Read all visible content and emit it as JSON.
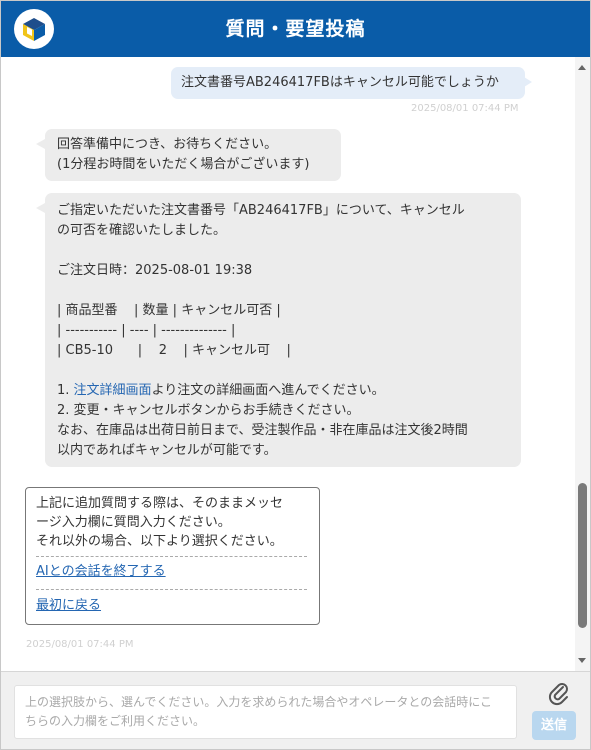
{
  "header": {
    "title": "質問・要望投稿",
    "logo": "cube-logo"
  },
  "messages": {
    "user_question": "注文書番号AB246417FBはキャンセル可能でしょうか",
    "user_timestamp": "2025/08/01 07:44 PM",
    "waiting": [
      "回答準備中につき、お待ちください。",
      "(1分程お時間をいただく場合がございます)"
    ],
    "answer": {
      "intro": [
        "ご指定いただいた注文書番号「AB246417FB」について、キャンセル",
        "の可否を確認いたしました。"
      ],
      "order_date": "ご注文日時：2025-08-01 19:38",
      "table": [
        "| 商品型番    | 数量 | キャンセル可否 |",
        "| ----------- | ---- | -------------- |",
        "| CB5-10      |    2    | キャンセル可    |"
      ],
      "step1_num": "1. ",
      "step1_link": "注文詳細画面",
      "step1_rest": "より注文の詳細画面へ進んでください。",
      "step2": "2. 変更・キャンセルボタンからお手続きください。",
      "note": [
        "なお、在庫品は出荷日前日まで、受注製作品・非在庫品は注文後2時間",
        "以内であればキャンセルが可能です。"
      ]
    },
    "choices": {
      "intro": [
        "上記に追加質問する際は、そのままメッセ",
        "ージ入力欄に質問入力ください。",
        "それ以外の場合、以下より選択ください。"
      ],
      "end_chat": "AIとの会話を終了する",
      "back_to_start": "最初に戻る"
    },
    "bot_timestamp": "2025/08/01 07:44 PM"
  },
  "input": {
    "placeholder_lines": [
      "上の選択肢から、選んでください。入力を求められた場合やオペレータとの会話時にこ",
      "ちらの入力欄をご利用ください。"
    ],
    "send_label": "送信",
    "attach_icon": "paperclip-icon"
  },
  "colors": {
    "header": "#0a5ca8",
    "user_bubble": "#e4edf8",
    "bot_bubble": "#ececec",
    "link": "#2466b2",
    "send_button": "#b9d7ef"
  }
}
